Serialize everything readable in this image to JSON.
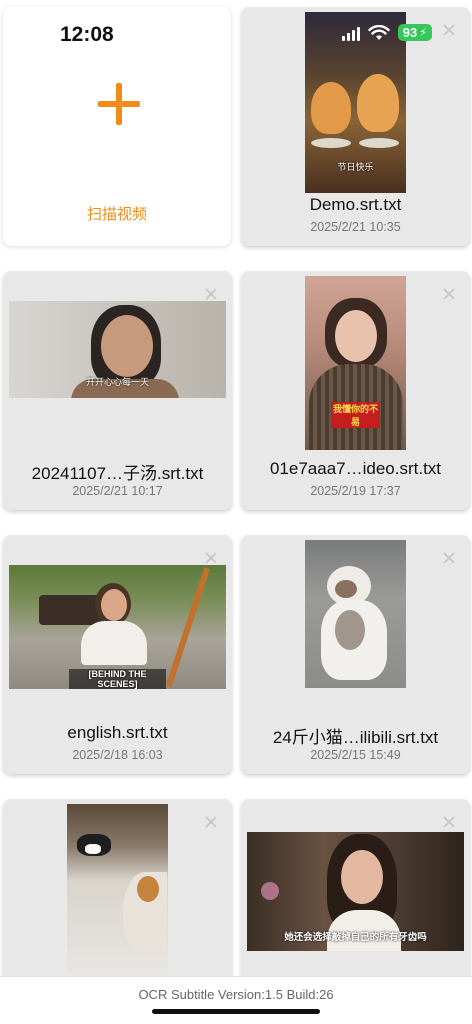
{
  "status_bar": {
    "time": "12:08",
    "battery": "93"
  },
  "add_card": {
    "label": "扫描视频"
  },
  "videos": [
    {
      "name": "Demo.srt.txt",
      "date": "2025/2/21 10:35",
      "subtitle": "节日快乐"
    },
    {
      "name": "20241107…子汤.srt.txt",
      "date": "2025/2/21 10:17",
      "subtitle": "开开心心每一天"
    },
    {
      "name": "01e7aaa7…ideo.srt.txt",
      "date": "2025/2/19 17:37",
      "subtitle": "我懂你的不易"
    },
    {
      "name": "english.srt.txt",
      "date": "2025/2/18 16:03",
      "subtitle": "[BEHIND THE SCENES]"
    },
    {
      "name": "24斤小猫…ilibili.srt.txt",
      "date": "2025/2/15 15:49",
      "subtitle": ""
    },
    {
      "name": "",
      "date": "",
      "subtitle": ""
    },
    {
      "name": "",
      "date": "",
      "subtitle": "她还会选择敲掉自己的所有牙齿吗"
    }
  ],
  "footer": {
    "version": "OCR Subtitle Version:1.5 Build:26"
  },
  "colors": {
    "accent": "#f28b1a",
    "card_bg": "#e8e8e8",
    "battery": "#34c759"
  }
}
